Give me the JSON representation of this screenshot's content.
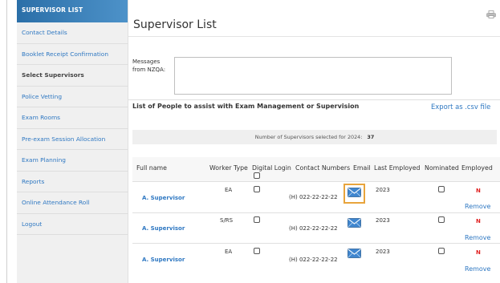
{
  "sidebar": {
    "header": "SUPERVISOR LIST",
    "items": [
      {
        "label": "Contact Details",
        "active": false
      },
      {
        "label": "Booklet Receipt Confirmation",
        "active": false
      },
      {
        "label": "Select Supervisors",
        "active": true
      },
      {
        "label": "Police Vetting",
        "active": false
      },
      {
        "label": "Exam Rooms",
        "active": false
      },
      {
        "label": "Pre-exam Session Allocation",
        "active": false
      },
      {
        "label": "Exam Planning",
        "active": false
      },
      {
        "label": "Reports",
        "active": false
      },
      {
        "label": "Online Attendance Roll",
        "active": false
      },
      {
        "label": "Logout",
        "active": false
      }
    ]
  },
  "main": {
    "title": "Supervisor List",
    "print_icon": "printer-icon",
    "messages_label": "Messages from NZQA:",
    "messages_value": "",
    "list_heading": "List of People to assist with Exam Management or Supervision",
    "export_label": "Export as .csv file",
    "count_label": "Number of Supervisors selected for 2024:",
    "count_value": "37"
  },
  "table": {
    "headers": [
      "Full name",
      "Worker Type",
      "Digital Login",
      "Contact Numbers",
      "Email",
      "Last Employed",
      "Nominated",
      "Employed"
    ],
    "rows": [
      {
        "name": "A. Supervisor",
        "worker_type": "EA",
        "digital_login": false,
        "contact": "(H) 022-22-22-22",
        "email_icon": "envelope-icon",
        "last_employed": "2023",
        "nominated": false,
        "employed": "N",
        "action": "Remove"
      },
      {
        "name": "A. Supervisor",
        "worker_type": "S/RS",
        "digital_login": false,
        "contact": "(H) 022-22-22-22",
        "email_icon": "envelope-icon",
        "last_employed": "2023",
        "nominated": false,
        "employed": "N",
        "action": "Remove"
      },
      {
        "name": "A. Supervisor",
        "worker_type": "EA",
        "digital_login": false,
        "contact": "(H) 022-22-22-22",
        "email_icon": "envelope-icon",
        "last_employed": "2023",
        "nominated": false,
        "employed": "N",
        "action": "Remove"
      }
    ]
  },
  "colors": {
    "accent": "#2f78c2",
    "header_gradient_start": "#2b6fa8",
    "highlight": "#e8a43c",
    "employed_no": "#e02020"
  }
}
